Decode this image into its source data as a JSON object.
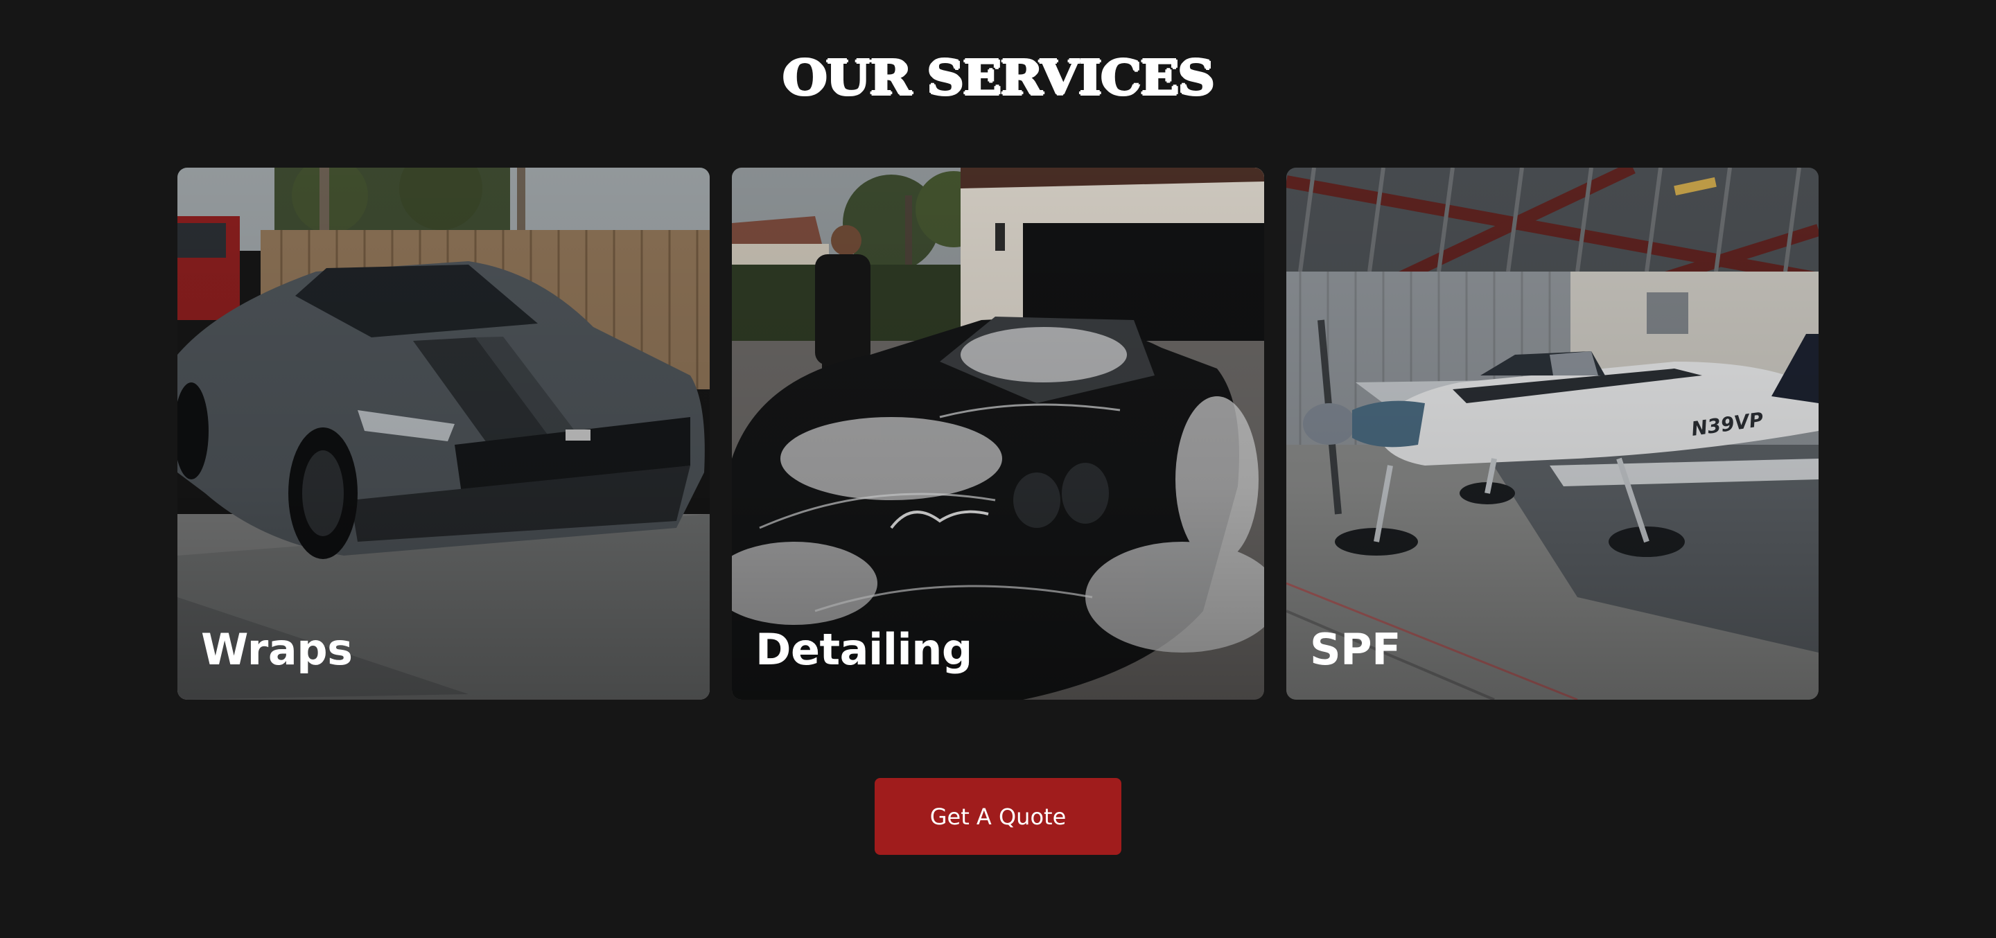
{
  "services": {
    "title": "OUR SERVICES",
    "cards": [
      {
        "label": "Wraps"
      },
      {
        "label": "Detailing"
      },
      {
        "label": "SPF"
      }
    ]
  },
  "cta": {
    "label": "Get A Quote"
  },
  "colors": {
    "background": "#161616",
    "button": "#a01c1c",
    "text": "#ffffff"
  }
}
